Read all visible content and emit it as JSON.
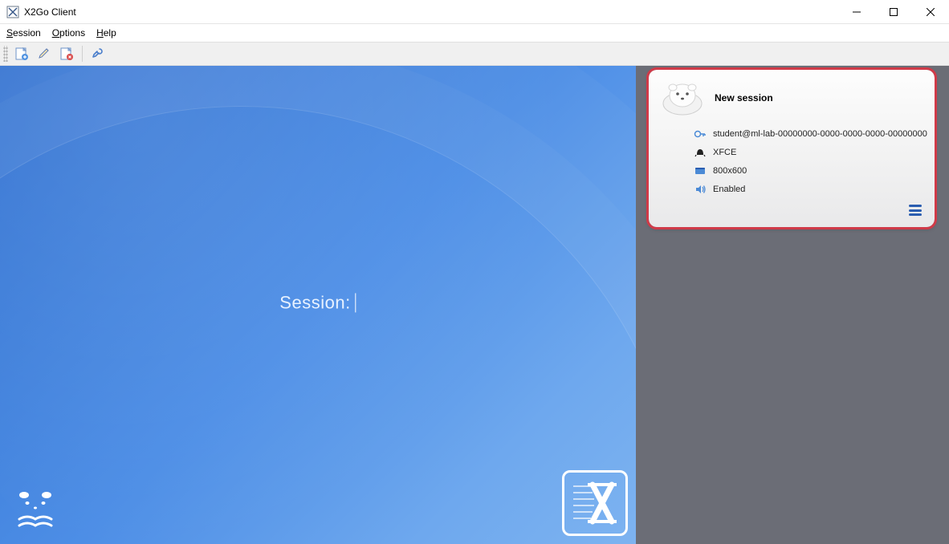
{
  "window": {
    "title": "X2Go Client"
  },
  "menu": {
    "session": "Session",
    "options": "Options",
    "help": "Help"
  },
  "main": {
    "session_label": "Session:"
  },
  "session_card": {
    "title": "New session",
    "connection": "student@ml-lab-00000000-0000-0000-0000-00000000",
    "desktop": "XFCE",
    "resolution": "800x600",
    "sound": "Enabled"
  }
}
